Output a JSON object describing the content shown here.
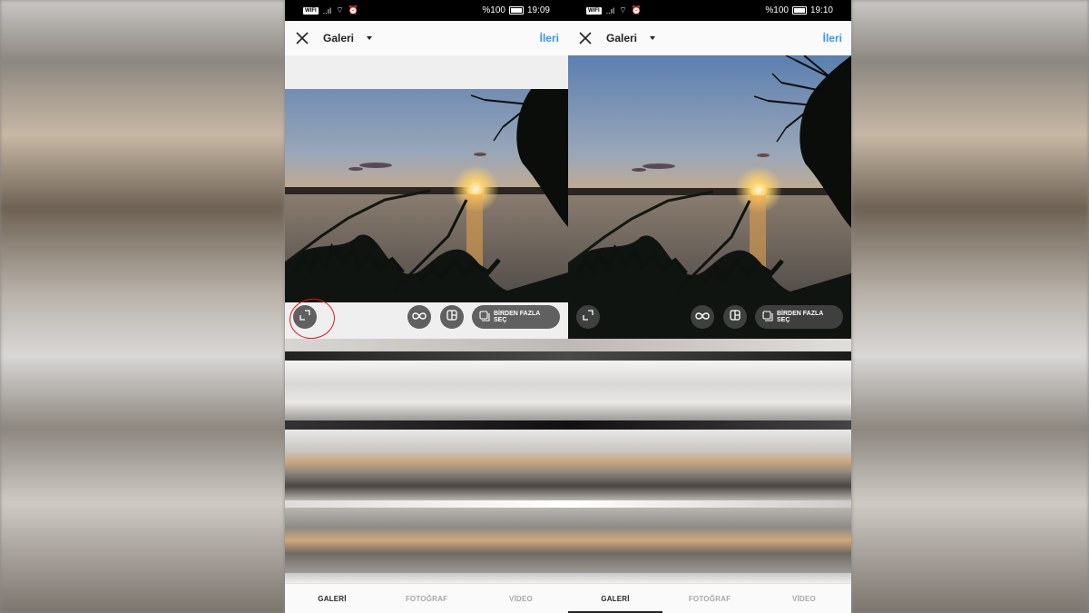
{
  "left_screen": {
    "status": {
      "wifi_badge": "WIFI",
      "signal": "..ıl",
      "battery": "%100",
      "time": "19:09"
    },
    "appbar": {
      "title": "Galeri",
      "next": "İleri"
    },
    "controls": {
      "multi_select": "BİRDEN FAZLA SEÇ"
    },
    "tabs": [
      {
        "label": "GALERİ",
        "active": true
      },
      {
        "label": "FOTOĞRAF",
        "active": false
      },
      {
        "label": "VİDEO",
        "active": false
      }
    ]
  },
  "right_screen": {
    "status": {
      "wifi_badge": "WIFI",
      "signal": "..ıl",
      "battery": "%100",
      "time": "19:10"
    },
    "appbar": {
      "title": "Galeri",
      "next": "İleri"
    },
    "controls": {
      "multi_select": "BİRDEN FAZLA SEÇ"
    },
    "tabs": [
      {
        "label": "GALERİ",
        "active": true
      },
      {
        "label": "FOTOĞRAF",
        "active": false
      },
      {
        "label": "VİDEO",
        "active": false
      }
    ]
  },
  "colors": {
    "accent": "#3897f0",
    "highlight": "#e01717",
    "statusbar": "#000000",
    "button_bg": "#464646"
  },
  "icons": [
    "close-icon",
    "chevron-down-icon",
    "expand-icon",
    "boomerang-icon",
    "layout-icon",
    "multi-select-icon",
    "wifi-icon",
    "alarm-icon",
    "battery-icon"
  ]
}
